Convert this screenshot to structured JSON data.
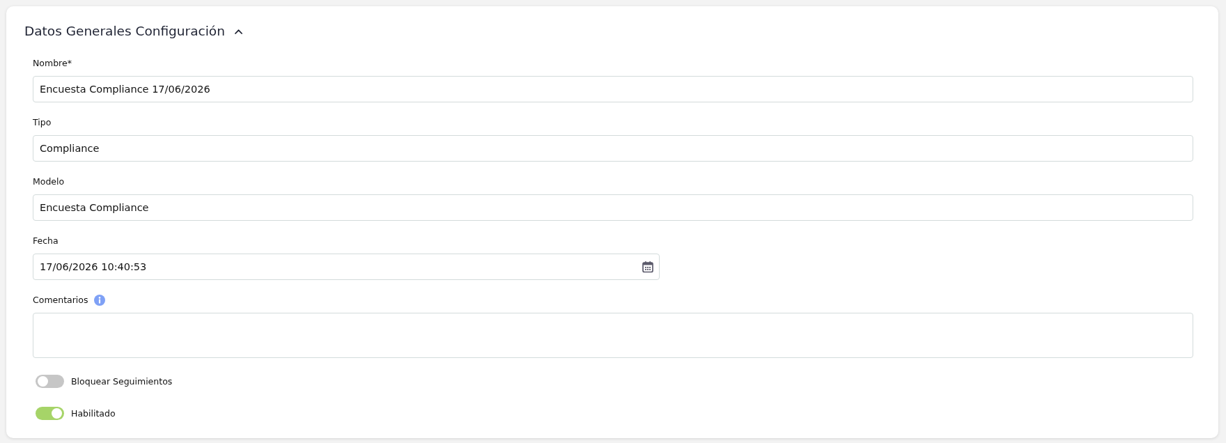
{
  "section": {
    "title": "Datos Generales Configuración",
    "expanded": true
  },
  "fields": [
    {
      "kind": "text",
      "label": "Nombre*",
      "value": "Encuesta Compliance 17/06/2026"
    },
    {
      "kind": "text",
      "label": "Tipo",
      "value": "Compliance"
    },
    {
      "kind": "text",
      "label": "Modelo",
      "value": "Encuesta Compliance"
    },
    {
      "kind": "date",
      "label": "Fecha",
      "value": "17/06/2026 10:40:53"
    },
    {
      "kind": "textarea",
      "label": "Comentarios",
      "info": true
    }
  ],
  "toggles": [
    {
      "label": "Bloquear Seguimientos",
      "on": false
    },
    {
      "label": "Habilitado",
      "on": true
    }
  ]
}
